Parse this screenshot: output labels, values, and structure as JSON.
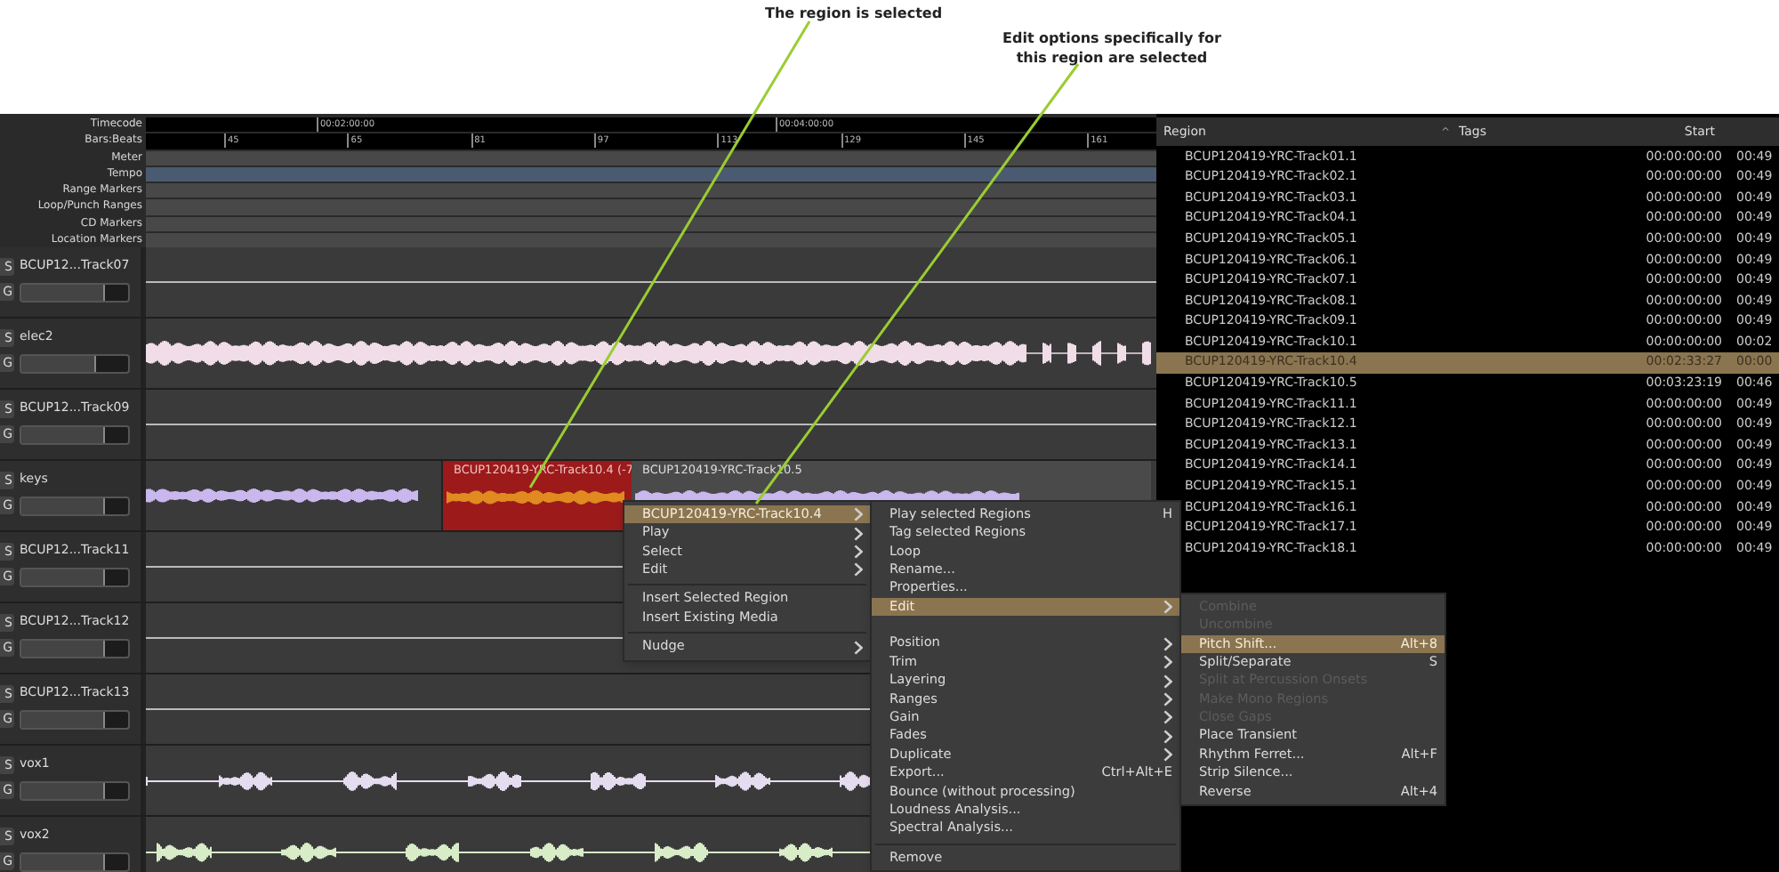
{
  "annotations": [
    {
      "text": "The region is selected"
    },
    {
      "text": "Edit options specifically for this region are selected"
    }
  ],
  "rulers": [
    {
      "label": "Timecode",
      "kind": "timecode"
    },
    {
      "label": "Bars:Beats",
      "kind": "bars"
    },
    {
      "label": "Meter",
      "kind": "lane"
    },
    {
      "label": "Tempo",
      "kind": "tempo"
    },
    {
      "label": "Range Markers",
      "kind": "lane"
    },
    {
      "label": "Loop/Punch Ranges",
      "kind": "lane"
    },
    {
      "label": "CD Markers",
      "kind": "lane"
    },
    {
      "label": "Location Markers",
      "kind": "lane"
    }
  ],
  "timecode_labels": [
    "00:02:00:00",
    "00:04:00:00"
  ],
  "bar_labels": [
    "45",
    "65",
    "81",
    "97",
    "113",
    "129",
    "145",
    "161"
  ],
  "tracks": [
    {
      "name": "BCUP12...Track07",
      "buttons": [
        "S",
        "G"
      ],
      "level": 0.78,
      "kind": "flat"
    },
    {
      "name": "elec2",
      "buttons": [
        "S",
        "G"
      ],
      "level": 0.7,
      "kind": "dense",
      "color": "#f0dde8"
    },
    {
      "name": "BCUP12...Track09",
      "buttons": [
        "S",
        "G"
      ],
      "level": 0.78,
      "kind": "flat"
    },
    {
      "name": "keys",
      "buttons": [
        "S",
        "G"
      ],
      "level": 0.78,
      "kind": "keys",
      "color": "#c9b8ee",
      "regions": [
        {
          "label": "BCUP120419-YRC-Track10.4 (-7",
          "selected": true
        },
        {
          "label": "BCUP120419-YRC-Track10.5",
          "selected": false
        }
      ]
    },
    {
      "name": "BCUP12...Track11",
      "buttons": [
        "S",
        "G"
      ],
      "level": 0.78,
      "kind": "flat"
    },
    {
      "name": "BCUP12...Track12",
      "buttons": [
        "S",
        "G"
      ],
      "level": 0.78,
      "kind": "flat"
    },
    {
      "name": "BCUP12...Track13",
      "buttons": [
        "S",
        "G"
      ],
      "level": 0.78,
      "kind": "flat"
    },
    {
      "name": "vox1",
      "buttons": [
        "S",
        "G"
      ],
      "level": 0.78,
      "kind": "sparse",
      "color": "#e6dcf0"
    },
    {
      "name": "vox2",
      "buttons": [
        "S",
        "G"
      ],
      "level": 0.78,
      "kind": "sparse",
      "color": "#d8ecc8"
    }
  ],
  "region_list": {
    "columns": [
      "Region",
      "Tags",
      "Start"
    ],
    "sort_indicator": "^",
    "rows": [
      {
        "name": "BCUP120419-YRC-Track01.1",
        "start": "00:00:00:00",
        "column_4": "00:49",
        "selected": false
      },
      {
        "name": "BCUP120419-YRC-Track02.1",
        "start": "00:00:00:00",
        "column_4": "00:49",
        "selected": false
      },
      {
        "name": "BCUP120419-YRC-Track03.1",
        "start": "00:00:00:00",
        "column_4": "00:49",
        "selected": false
      },
      {
        "name": "BCUP120419-YRC-Track04.1",
        "start": "00:00:00:00",
        "column_4": "00:49",
        "selected": false
      },
      {
        "name": "BCUP120419-YRC-Track05.1",
        "start": "00:00:00:00",
        "column_4": "00:49",
        "selected": false
      },
      {
        "name": "BCUP120419-YRC-Track06.1",
        "start": "00:00:00:00",
        "column_4": "00:49",
        "selected": false
      },
      {
        "name": "BCUP120419-YRC-Track07.1",
        "start": "00:00:00:00",
        "column_4": "00:49",
        "selected": false
      },
      {
        "name": "BCUP120419-YRC-Track08.1",
        "start": "00:00:00:00",
        "column_4": "00:49",
        "selected": false
      },
      {
        "name": "BCUP120419-YRC-Track09.1",
        "start": "00:00:00:00",
        "column_4": "00:49",
        "selected": false
      },
      {
        "name": "BCUP120419-YRC-Track10.1",
        "start": "00:00:00:00",
        "column_4": "00:02",
        "selected": false
      },
      {
        "name": "BCUP120419-YRC-Track10.4",
        "start": "00:02:33:27",
        "column_4": "00:00",
        "selected": true
      },
      {
        "name": "BCUP120419-YRC-Track10.5",
        "start": "00:03:23:19",
        "column_4": "00:46",
        "selected": false
      },
      {
        "name": "BCUP120419-YRC-Track11.1",
        "start": "00:00:00:00",
        "column_4": "00:49",
        "selected": false
      },
      {
        "name": "BCUP120419-YRC-Track12.1",
        "start": "00:00:00:00",
        "column_4": "00:49",
        "selected": false
      },
      {
        "name": "BCUP120419-YRC-Track13.1",
        "start": "00:00:00:00",
        "column_4": "00:49",
        "selected": false
      },
      {
        "name": "BCUP120419-YRC-Track14.1",
        "start": "00:00:00:00",
        "column_4": "00:49",
        "selected": false
      },
      {
        "name": "BCUP120419-YRC-Track15.1",
        "start": "00:00:00:00",
        "column_4": "00:49",
        "selected": false
      },
      {
        "name": "BCUP120419-YRC-Track16.1",
        "start": "00:00:00:00",
        "column_4": "00:49",
        "selected": false
      },
      {
        "name": "BCUP120419-YRC-Track17.1",
        "start": "00:00:00:00",
        "column_4": "00:49",
        "selected": false
      },
      {
        "name": "BCUP120419-YRC-Track18.1",
        "start": "00:00:00:00",
        "column_4": "00:49",
        "selected": false
      }
    ]
  },
  "menus": [
    {
      "items": [
        {
          "kind": "item",
          "label": "BCUP120419-YRC-Track10.4",
          "submenu": true,
          "selected": true,
          "disabled": false
        },
        {
          "kind": "item",
          "label": "Play",
          "submenu": true,
          "selected": false,
          "disabled": false
        },
        {
          "kind": "item",
          "label": "Select",
          "submenu": true,
          "selected": false,
          "disabled": false
        },
        {
          "kind": "item",
          "label": "Edit",
          "submenu": true,
          "selected": false,
          "disabled": false
        },
        {
          "kind": "separator"
        },
        {
          "kind": "item",
          "label": "Insert Selected Region",
          "selected": false,
          "disabled": false
        },
        {
          "kind": "item",
          "label": "Insert Existing Media",
          "selected": false,
          "disabled": false
        },
        {
          "kind": "separator"
        },
        {
          "kind": "item",
          "label": "Nudge",
          "submenu": true,
          "selected": false,
          "disabled": false
        }
      ]
    },
    {
      "items": [
        {
          "kind": "item",
          "label": "Play selected Regions",
          "shortcut": "H",
          "selected": false,
          "disabled": false
        },
        {
          "kind": "item",
          "label": "Tag selected Regions",
          "selected": false,
          "disabled": false
        },
        {
          "kind": "item",
          "label": "Loop",
          "selected": false,
          "disabled": false
        },
        {
          "kind": "item",
          "label": "Rename...",
          "selected": false,
          "disabled": false
        },
        {
          "kind": "item",
          "label": "Properties...",
          "selected": false,
          "disabled": false
        },
        {
          "kind": "item",
          "label": "Edit",
          "submenu": true,
          "selected": true,
          "disabled": false
        },
        {
          "kind": "blank"
        },
        {
          "kind": "item",
          "label": "Position",
          "submenu": true,
          "selected": false,
          "disabled": false
        },
        {
          "kind": "item",
          "label": "Trim",
          "submenu": true,
          "selected": false,
          "disabled": false
        },
        {
          "kind": "item",
          "label": "Layering",
          "submenu": true,
          "selected": false,
          "disabled": false
        },
        {
          "kind": "item",
          "label": "Ranges",
          "submenu": true,
          "selected": false,
          "disabled": false
        },
        {
          "kind": "item",
          "label": "Gain",
          "submenu": true,
          "selected": false,
          "disabled": false
        },
        {
          "kind": "item",
          "label": "Fades",
          "submenu": true,
          "selected": false,
          "disabled": false
        },
        {
          "kind": "item",
          "label": "Duplicate",
          "submenu": true,
          "selected": false,
          "disabled": false
        },
        {
          "kind": "item",
          "label": "Export...",
          "shortcut": "Ctrl+Alt+E",
          "selected": false,
          "disabled": false
        },
        {
          "kind": "item",
          "label": "Bounce (without processing)",
          "selected": false,
          "disabled": false
        },
        {
          "kind": "item",
          "label": "Loudness Analysis...",
          "selected": false,
          "disabled": false
        },
        {
          "kind": "item",
          "label": "Spectral Analysis...",
          "selected": false,
          "disabled": false
        },
        {
          "kind": "separator"
        },
        {
          "kind": "item",
          "label": "Remove",
          "selected": false,
          "disabled": false
        }
      ]
    },
    {
      "items": [
        {
          "kind": "item",
          "label": "Combine",
          "selected": false,
          "disabled": true
        },
        {
          "kind": "item",
          "label": "Uncombine",
          "selected": false,
          "disabled": true
        },
        {
          "kind": "item",
          "label": "Pitch Shift...",
          "shortcut": "Alt+8",
          "selected": true,
          "disabled": false
        },
        {
          "kind": "item",
          "label": "Split/Separate",
          "shortcut": "S",
          "selected": false,
          "disabled": false
        },
        {
          "kind": "item",
          "label": "Split at Percussion Onsets",
          "selected": false,
          "disabled": true
        },
        {
          "kind": "item",
          "label": "Make Mono Regions",
          "selected": false,
          "disabled": true
        },
        {
          "kind": "item",
          "label": "Close Gaps",
          "selected": false,
          "disabled": true
        },
        {
          "kind": "item",
          "label": "Place Transient",
          "selected": false,
          "disabled": false
        },
        {
          "kind": "item",
          "label": "Rhythm Ferret...",
          "shortcut": "Alt+F",
          "selected": false,
          "disabled": false
        },
        {
          "kind": "item",
          "label": "Strip Silence...",
          "selected": false,
          "disabled": false
        },
        {
          "kind": "item",
          "label": "Reverse",
          "shortcut": "Alt+4",
          "selected": false,
          "disabled": false
        }
      ]
    }
  ]
}
